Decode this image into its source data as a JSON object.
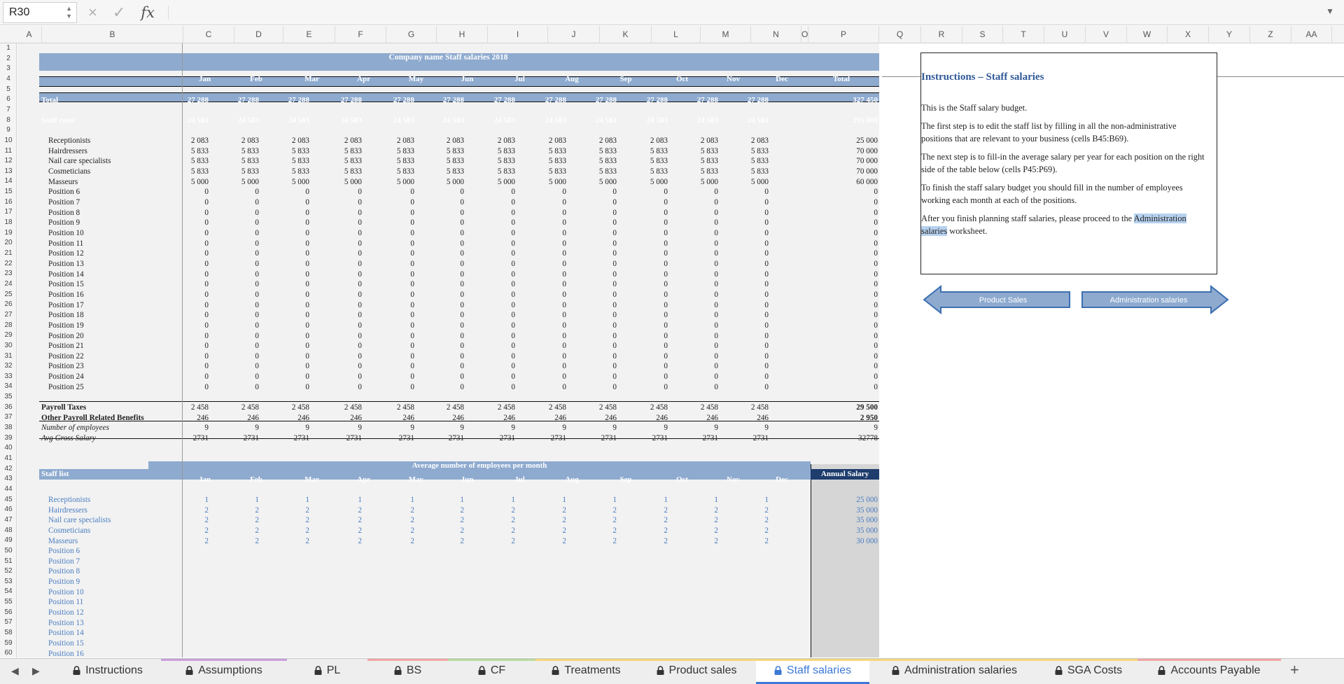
{
  "name_box": "R30",
  "formula_bar": {
    "cancel_icon": "×",
    "enter_icon": "✓",
    "fx_label": "fx",
    "value": ""
  },
  "columns": [
    "A",
    "B",
    "C",
    "D",
    "E",
    "F",
    "G",
    "H",
    "I",
    "J",
    "K",
    "L",
    "M",
    "N",
    "O",
    "P",
    "Q",
    "R",
    "S",
    "T",
    "U",
    "V",
    "W",
    "X",
    "Y",
    "Z",
    "AA"
  ],
  "rows": [
    "1",
    "2",
    "3",
    "4",
    "5",
    "6",
    "7",
    "8",
    "9",
    "10",
    "11",
    "12",
    "13",
    "14",
    "15",
    "16",
    "17",
    "18",
    "19",
    "20",
    "21",
    "22",
    "23",
    "24",
    "25",
    "26",
    "27",
    "28",
    "29",
    "30",
    "31",
    "32",
    "33",
    "34",
    "35",
    "36",
    "37",
    "38",
    "39",
    "40",
    "41",
    "42",
    "43",
    "44",
    "45",
    "46",
    "47",
    "48",
    "49",
    "50",
    "51",
    "52",
    "53",
    "54",
    "55",
    "56",
    "57",
    "58",
    "59",
    "60"
  ],
  "table_title": "Company name Staff salaries 2018",
  "months": [
    "Jan",
    "Feb",
    "Mar",
    "Apr",
    "May",
    "Jun",
    "Jul",
    "Aug",
    "Sep",
    "Oct",
    "Nov",
    "Dec"
  ],
  "total_header": "Total",
  "total_row": {
    "label": "Total",
    "values": [
      "27 288",
      "27 288",
      "27 288",
      "27 288",
      "27 288",
      "27 288",
      "27 288",
      "27 288",
      "27 288",
      "27 288",
      "27 288",
      "27 288"
    ],
    "total": "327 450"
  },
  "staff_costs_row": {
    "label": "Staff costs",
    "values": [
      "24 583",
      "24 583",
      "24 583",
      "24 583",
      "24 583",
      "24 583",
      "24 583",
      "24 583",
      "24 583",
      "24 583",
      "24 583",
      "24 583"
    ],
    "total": "295 000"
  },
  "positions": [
    {
      "name": "Receptionists",
      "monthly": "2 083",
      "total": "25 000"
    },
    {
      "name": "Hairdressers",
      "monthly": "5 833",
      "total": "70 000"
    },
    {
      "name": "Nail care specialists",
      "monthly": "5 833",
      "total": "70 000"
    },
    {
      "name": "Cosmeticians",
      "monthly": "5 833",
      "total": "70 000"
    },
    {
      "name": "Masseurs",
      "monthly": "5 000",
      "total": "60 000"
    },
    {
      "name": "Position 6",
      "monthly": "0",
      "total": "0"
    },
    {
      "name": "Position 7",
      "monthly": "0",
      "total": "0"
    },
    {
      "name": "Position 8",
      "monthly": "0",
      "total": "0"
    },
    {
      "name": "Position 9",
      "monthly": "0",
      "total": "0"
    },
    {
      "name": "Position 10",
      "monthly": "0",
      "total": "0"
    },
    {
      "name": "Position 11",
      "monthly": "0",
      "total": "0"
    },
    {
      "name": "Position 12",
      "monthly": "0",
      "total": "0"
    },
    {
      "name": "Position 13",
      "monthly": "0",
      "total": "0"
    },
    {
      "name": "Position 14",
      "monthly": "0",
      "total": "0"
    },
    {
      "name": "Position 15",
      "monthly": "0",
      "total": "0"
    },
    {
      "name": "Position 16",
      "monthly": "0",
      "total": "0"
    },
    {
      "name": "Position 17",
      "monthly": "0",
      "total": "0"
    },
    {
      "name": "Position 18",
      "monthly": "0",
      "total": "0"
    },
    {
      "name": "Position 19",
      "monthly": "0",
      "total": "0"
    },
    {
      "name": "Position 20",
      "monthly": "0",
      "total": "0"
    },
    {
      "name": "Position 21",
      "monthly": "0",
      "total": "0"
    },
    {
      "name": "Position 22",
      "monthly": "0",
      "total": "0"
    },
    {
      "name": "Position 23",
      "monthly": "0",
      "total": "0"
    },
    {
      "name": "Position 24",
      "monthly": "0",
      "total": "0"
    },
    {
      "name": "Position 25",
      "monthly": "0",
      "total": "0"
    }
  ],
  "summary_rows": [
    {
      "label": "Payroll Taxes",
      "monthly": "2 458",
      "total": "29 500",
      "style": "bold"
    },
    {
      "label": "Other Payroll Related Benefits",
      "monthly": "246",
      "total": "2 950",
      "style": "bold"
    },
    {
      "label": "Number of employees",
      "monthly": "9",
      "total": "9",
      "style": "italic"
    },
    {
      "label": "Avg Gross Salary",
      "monthly": "2731",
      "total": "32778",
      "style": "italic"
    }
  ],
  "avg_title": "Average number of employees per month",
  "staff_list_label": "Staff list",
  "annual_salary_label": "Annual Salary",
  "staff_list": [
    {
      "name": "Receptionists",
      "count": "1",
      "salary": "25 000"
    },
    {
      "name": "Hairdressers",
      "count": "2",
      "salary": "35 000"
    },
    {
      "name": "Nail care specialists",
      "count": "2",
      "salary": "35 000"
    },
    {
      "name": "Cosmeticians",
      "count": "2",
      "salary": "35 000"
    },
    {
      "name": "Masseurs",
      "count": "2",
      "salary": "30 000"
    },
    {
      "name": "Position 6",
      "count": "",
      "salary": ""
    },
    {
      "name": "Position 7",
      "count": "",
      "salary": ""
    },
    {
      "name": "Position 8",
      "count": "",
      "salary": ""
    },
    {
      "name": "Position 9",
      "count": "",
      "salary": ""
    },
    {
      "name": "Position 10",
      "count": "",
      "salary": ""
    },
    {
      "name": "Position 11",
      "count": "",
      "salary": ""
    },
    {
      "name": "Position 12",
      "count": "",
      "salary": ""
    },
    {
      "name": "Position 13",
      "count": "",
      "salary": ""
    },
    {
      "name": "Position 14",
      "count": "",
      "salary": ""
    },
    {
      "name": "Position 15",
      "count": "",
      "salary": ""
    },
    {
      "name": "Position 16",
      "count": "",
      "salary": ""
    }
  ],
  "instructions": {
    "title": "Instructions – Staff salaries",
    "p1": "This is the Staff salary budget.",
    "p2": "The first step is to edit the staff list by filling in all the non-administrative positions that are relevant to your business (cells B45:B69).",
    "p3": "The next step is to fill-in the average salary per year for each position on the right side of the table below (cells P45:P69).",
    "p4": "To finish the staff salary budget you should fill in the number of employees working each month at each of the positions.",
    "p5_highlight": "Administration salaries",
    "p5_before": "After you finish planning staff salaries, please proceed to the ",
    "p5_after": " worksheet."
  },
  "nav_buttons": {
    "prev": "Product Sales",
    "next": "Administration salaries"
  },
  "sheet_tabs": [
    {
      "label": "Instructions",
      "stripe": ""
    },
    {
      "label": "Assumptions",
      "stripe": "#c9a0dc"
    },
    {
      "label": "PL",
      "stripe": ""
    },
    {
      "label": "BS",
      "stripe": "#f2a6a6"
    },
    {
      "label": "CF",
      "stripe": "#b9dba0"
    },
    {
      "label": "Treatments",
      "stripe": "#f5d77a"
    },
    {
      "label": "Product sales",
      "stripe": "#f5d77a"
    },
    {
      "label": "Staff salaries",
      "stripe": "#f5d77a",
      "active": true
    },
    {
      "label": "Administration salaries",
      "stripe": "#f5d77a"
    },
    {
      "label": "SGA Costs",
      "stripe": "#f5d77a"
    },
    {
      "label": "Accounts Payable",
      "stripe": "#f2a6a6"
    }
  ],
  "add_sheet_label": "+",
  "colors": {
    "band": "#8eaacf",
    "accent": "#3c79d6",
    "title": "#2f5897",
    "input_blue": "#4a7dc0"
  }
}
